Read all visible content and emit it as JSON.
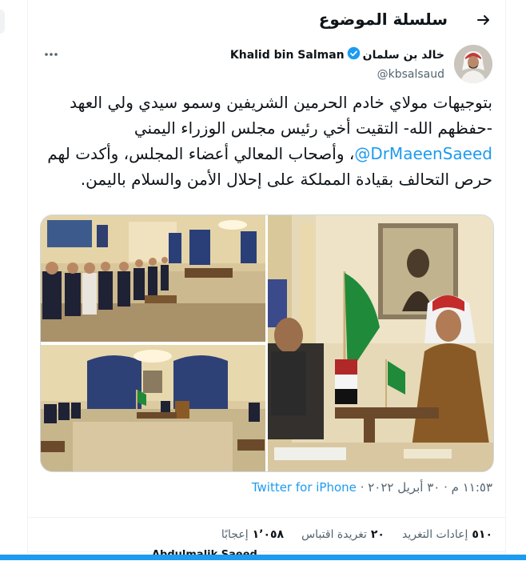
{
  "header": {
    "title": "سلسلة الموضوع",
    "back_icon": "arrow-right-icon"
  },
  "author": {
    "name_en": "Khalid bin Salman",
    "name_ar": "خالد بن سلمان",
    "handle": "@kbsalsaud",
    "verified_icon": "verified-badge-icon",
    "more_icon": "more-dots-icon"
  },
  "tweet": {
    "text_before": "بتوجيهات مولاي خادم الحرمين الشريفين وسمو سيدي ولي العهد -حفظهم الله- التقيت أخي رئيس مجلس الوزراء اليمني ",
    "mention": "@DrMaeenSaeed",
    "text_after": "، وأصحاب المعالي أعضاء المجلس، وأكدت لهم حرص التحالف بقيادة المملكة على إحلال الأمن والسلام باليمن."
  },
  "meta": {
    "time": "١١:٥٣ م",
    "date": "٣٠ أبريل ٢٠٢٢",
    "separator": "·",
    "source": "Twitter for iPhone"
  },
  "stats": {
    "retweets_count": "٥١٠",
    "retweets_label": "إعادات التغريد",
    "quotes_count": "٢٠",
    "quotes_label": "تغريدة اقتباس",
    "likes_count": "١٬٠٥٨",
    "likes_label": "إعجابًا"
  },
  "bottom": {
    "partial_text": "Abdulmalik Saeed"
  },
  "colors": {
    "accent": "#1d9bf0",
    "text": "#0f1419",
    "muted": "#536471",
    "border": "#eff3f4"
  }
}
